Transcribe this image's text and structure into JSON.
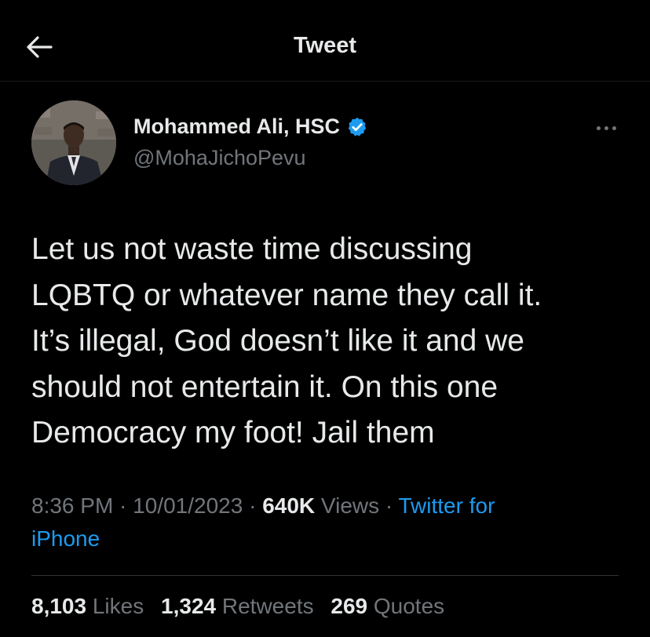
{
  "header": {
    "title": "Tweet",
    "back_icon": "arrow-left-icon"
  },
  "author": {
    "name": "Mohammed Ali, HSC",
    "handle": "@MohaJichoPevu",
    "verified": true,
    "verified_color": "#1d9bf0"
  },
  "tweet": {
    "text": "Let us not waste time discussing\nLQBTQ or whatever name they call it.\nIt’s illegal, God doesn’t like it and we\nshould not entertain it. On this one\nDemocracy my foot! Jail them"
  },
  "meta": {
    "time": "8:36 PM",
    "date": "10/01/2023",
    "views_count": "640K",
    "views_label": "Views",
    "source_line1": "Twitter for",
    "source_line2": "iPhone",
    "separator": " · "
  },
  "stats": {
    "likes_count": "8,103",
    "likes_label": "Likes",
    "retweets_count": "1,324",
    "retweets_label": "Retweets",
    "quotes_count": "269",
    "quotes_label": "Quotes"
  },
  "colors": {
    "background": "#000000",
    "text": "#e7e9ea",
    "secondary": "#71767b",
    "link": "#1d9bf0"
  }
}
